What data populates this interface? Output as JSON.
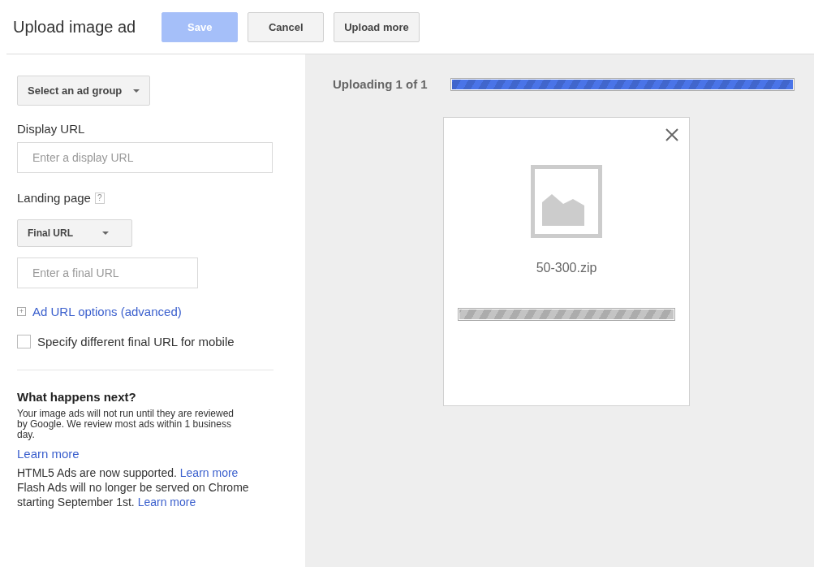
{
  "header": {
    "title": "Upload image ad",
    "buttons": [
      {
        "label": "Save",
        "kind": "primary",
        "disabled": true
      },
      {
        "label": "Cancel",
        "kind": "default",
        "disabled": false
      },
      {
        "label": "Upload more",
        "kind": "default",
        "disabled": false
      }
    ]
  },
  "form": {
    "ad_group": {
      "label": "Select an ad group"
    },
    "display_url": {
      "label": "Display URL",
      "placeholder": "Enter a display URL"
    },
    "landing_page": {
      "label": "Landing page",
      "help": "?",
      "url_type": "Final URL",
      "placeholder": "Enter a final URL"
    },
    "advanced": {
      "icon": "+",
      "label": "Ad URL options (advanced)",
      "expanded": false
    },
    "mobile": {
      "label": "Specify different final URL for mobile",
      "checked": false
    }
  },
  "info": {
    "title": "What happens next?",
    "text": "Your image ads will not run until they are reviewed by Google. We review most ads within 1 business day.",
    "link": "Learn more",
    "notes": [
      {
        "text": "HTML5 Ads are now supported.",
        "link": "Learn more"
      },
      {
        "text": "Flash Ads will no longer be served on Chrome starting September 1st.",
        "link": "Learn more"
      }
    ]
  },
  "upload": {
    "status": "Uploading 1 of 1",
    "level": 1,
    "file": {
      "name": "50-300.zip",
      "level": 1
    }
  }
}
